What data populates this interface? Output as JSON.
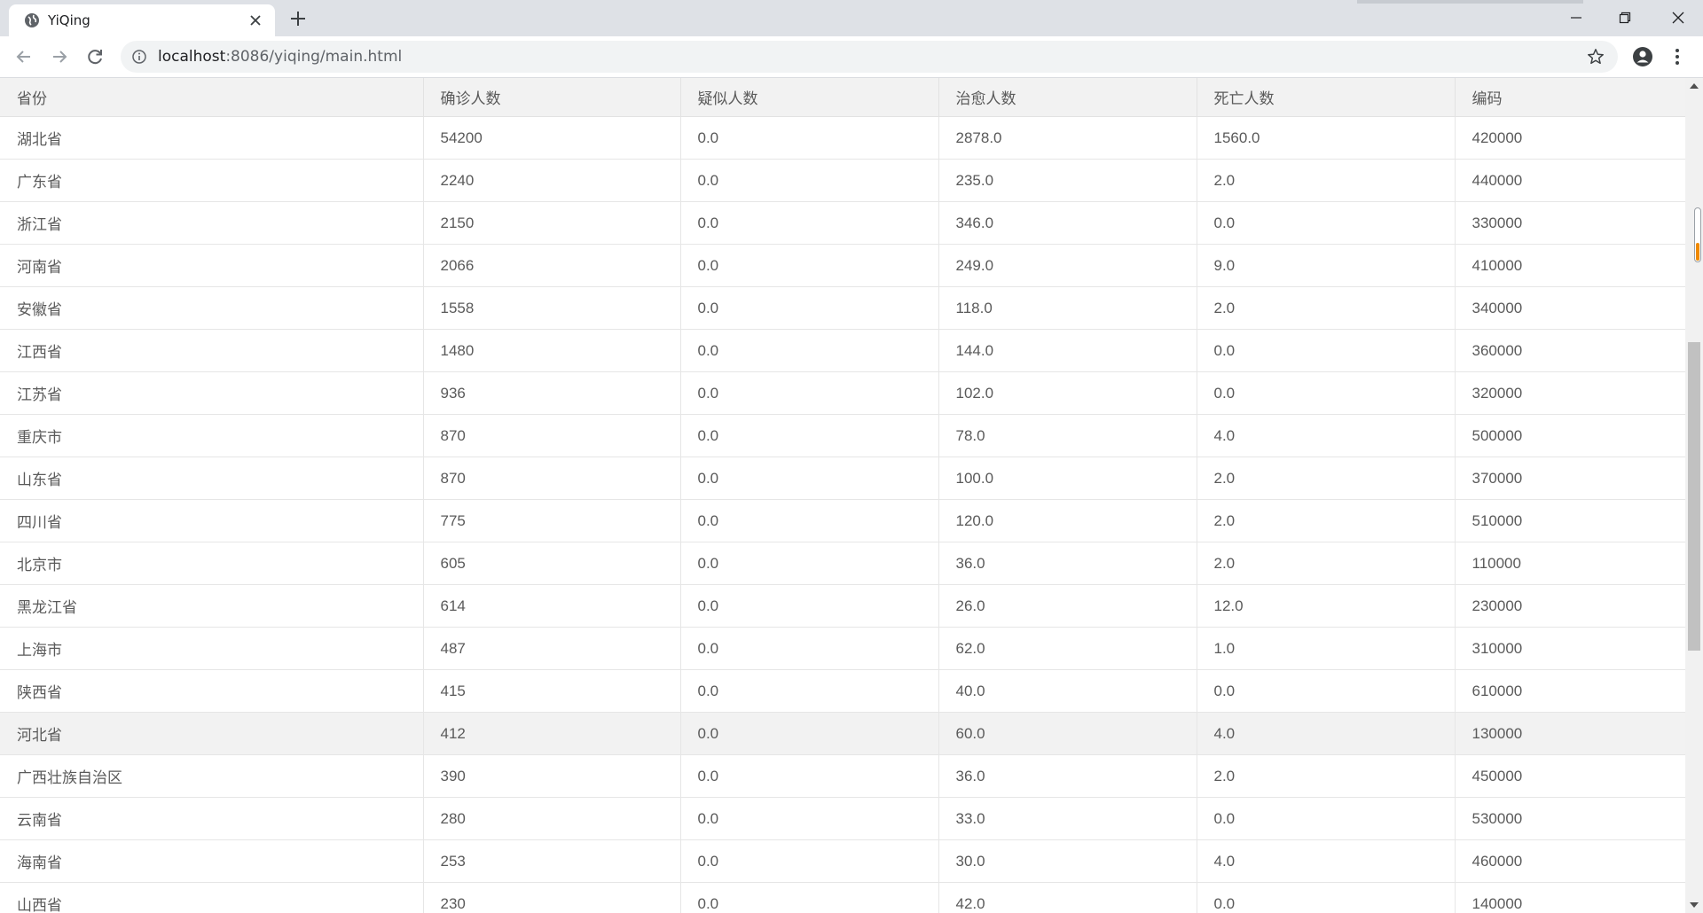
{
  "browser": {
    "tab_title": "YiQing",
    "url_host": "localhost",
    "url_rest": ":8086/yiqing/main.html",
    "icons": [
      "globe-icon",
      "close-icon",
      "plus-icon",
      "back-icon",
      "forward-icon",
      "reload-icon",
      "info-icon",
      "star-icon",
      "account-icon",
      "menu-icon",
      "minimize-icon",
      "maximize-icon",
      "window-close-icon"
    ]
  },
  "table": {
    "headers": [
      "省份",
      "确诊人数",
      "疑似人数",
      "治愈人数",
      "死亡人数",
      "编码"
    ],
    "hover_row_index": 14,
    "rows": [
      [
        "湖北省",
        "54200",
        "0.0",
        "2878.0",
        "1560.0",
        "420000"
      ],
      [
        "广东省",
        "2240",
        "0.0",
        "235.0",
        "2.0",
        "440000"
      ],
      [
        "浙江省",
        "2150",
        "0.0",
        "346.0",
        "0.0",
        "330000"
      ],
      [
        "河南省",
        "2066",
        "0.0",
        "249.0",
        "9.0",
        "410000"
      ],
      [
        "安徽省",
        "1558",
        "0.0",
        "118.0",
        "2.0",
        "340000"
      ],
      [
        "江西省",
        "1480",
        "0.0",
        "144.0",
        "0.0",
        "360000"
      ],
      [
        "江苏省",
        "936",
        "0.0",
        "102.0",
        "0.0",
        "320000"
      ],
      [
        "重庆市",
        "870",
        "0.0",
        "78.0",
        "4.0",
        "500000"
      ],
      [
        "山东省",
        "870",
        "0.0",
        "100.0",
        "2.0",
        "370000"
      ],
      [
        "四川省",
        "775",
        "0.0",
        "120.0",
        "2.0",
        "510000"
      ],
      [
        "北京市",
        "605",
        "0.0",
        "36.0",
        "2.0",
        "110000"
      ],
      [
        "黑龙江省",
        "614",
        "0.0",
        "26.0",
        "12.0",
        "230000"
      ],
      [
        "上海市",
        "487",
        "0.0",
        "62.0",
        "1.0",
        "310000"
      ],
      [
        "陕西省",
        "415",
        "0.0",
        "40.0",
        "0.0",
        "610000"
      ],
      [
        "河北省",
        "412",
        "0.0",
        "60.0",
        "4.0",
        "130000"
      ],
      [
        "广西壮族自治区",
        "390",
        "0.0",
        "36.0",
        "2.0",
        "450000"
      ],
      [
        "云南省",
        "280",
        "0.0",
        "33.0",
        "0.0",
        "530000"
      ],
      [
        "海南省",
        "253",
        "0.0",
        "30.0",
        "4.0",
        "460000"
      ],
      [
        "山西省",
        "230",
        "0.0",
        "42.0",
        "0.0",
        "140000"
      ]
    ]
  },
  "colors": {
    "tabbar": "#dee1e6",
    "header_bg": "#f2f2f2",
    "text": "#5a5a5a",
    "grid": "#e6e6e6",
    "scroll_indicator": "#f08a00"
  }
}
